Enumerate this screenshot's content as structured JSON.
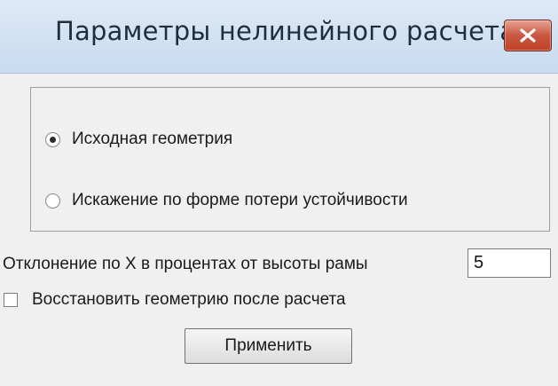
{
  "window": {
    "title": "Параметры нелинейного расчета",
    "close_icon": "close-icon"
  },
  "geometry_group": {
    "options": [
      {
        "label": "Исходная геометрия",
        "selected": true
      },
      {
        "label": "Искажение по форме потери устойчивости",
        "selected": false
      }
    ]
  },
  "deviation": {
    "label": "Отклонение по X в процентах от высоты рамы",
    "value": "5"
  },
  "restore_checkbox": {
    "label": "Восстановить геометрию после расчета",
    "checked": false
  },
  "apply_button": {
    "label": "Применить"
  },
  "colors": {
    "title_bar": "#c8dbf0",
    "close_button": "#c95741",
    "background": "#f0f0f0"
  }
}
